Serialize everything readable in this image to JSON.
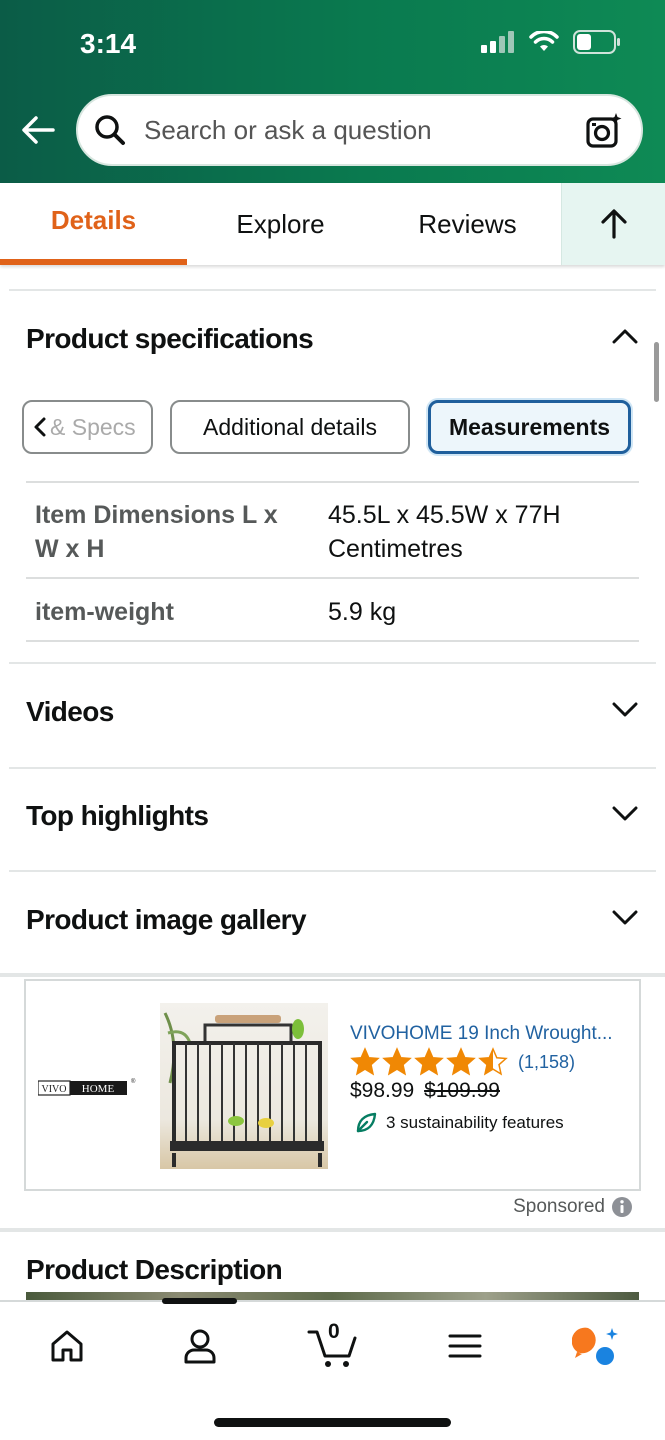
{
  "status_bar": {
    "time": "3:14"
  },
  "search": {
    "placeholder": "Search or ask a question"
  },
  "tabs": [
    {
      "label": "Details",
      "active": true
    },
    {
      "label": "Explore",
      "active": false
    },
    {
      "label": "Reviews",
      "active": false
    }
  ],
  "specs_section": {
    "title": "Product specifications",
    "pills": [
      {
        "label": "& Specs",
        "selected": false
      },
      {
        "label": "Additional details",
        "selected": false
      },
      {
        "label": "Measurements",
        "selected": true
      }
    ],
    "rows": [
      {
        "label": "Item Dimensions L x W x H",
        "value": "45.5L x 45.5W x 77H Centimetres"
      },
      {
        "label": "item-weight",
        "value": "5.9 kg"
      }
    ]
  },
  "collapsed_sections": {
    "videos": "Videos",
    "highlights": "Top highlights",
    "gallery": "Product image gallery"
  },
  "ad": {
    "brand": "VIVOHOME",
    "title": "VIVOHOME 19 Inch Wrought...",
    "rating": 4.5,
    "rating_count": "(1,158)",
    "price": "$98.99",
    "old_price": "$109.99",
    "sustainability": "3 sustainability features",
    "sponsored": "Sponsored"
  },
  "product_description": {
    "title": "Product Description"
  },
  "bottom_nav": {
    "cart_count": "0",
    "items": [
      "home-icon",
      "account-icon",
      "cart-icon",
      "menu-icon",
      "rufus-icon"
    ]
  },
  "colors": {
    "accent": "#e06219",
    "header_green": "#0a7a4f",
    "link": "#2162a1",
    "star": "#f08804"
  }
}
